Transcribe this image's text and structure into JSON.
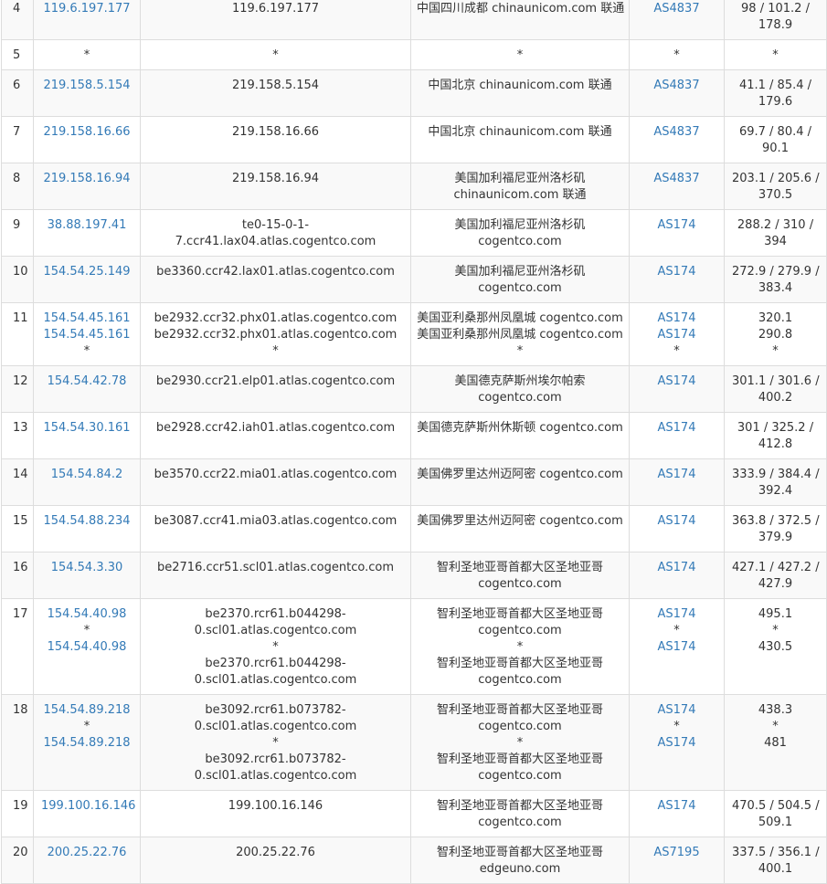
{
  "rows": [
    {
      "hop": "4",
      "ip": [
        "119.6.197.177"
      ],
      "host": [
        "119.6.197.177"
      ],
      "loc": [
        "中国四川成都 chinaunicom.com 联通"
      ],
      "as": [
        "AS4837"
      ],
      "rtt": "98 / 101.2 / 178.9"
    },
    {
      "hop": "5",
      "ip": [
        "*"
      ],
      "host": [
        "*"
      ],
      "loc": [
        "*"
      ],
      "as": [
        "*"
      ],
      "rtt": "*"
    },
    {
      "hop": "6",
      "ip": [
        "219.158.5.154"
      ],
      "host": [
        "219.158.5.154"
      ],
      "loc": [
        "中国北京 chinaunicom.com 联通"
      ],
      "as": [
        "AS4837"
      ],
      "rtt": "41.1 / 85.4 / 179.6"
    },
    {
      "hop": "7",
      "ip": [
        "219.158.16.66"
      ],
      "host": [
        "219.158.16.66"
      ],
      "loc": [
        "中国北京 chinaunicom.com 联通"
      ],
      "as": [
        "AS4837"
      ],
      "rtt": "69.7 / 80.4 / 90.1"
    },
    {
      "hop": "8",
      "ip": [
        "219.158.16.94"
      ],
      "host": [
        "219.158.16.94"
      ],
      "loc": [
        "美国加利福尼亚州洛杉矶 chinaunicom.com 联通"
      ],
      "as": [
        "AS4837"
      ],
      "rtt": "203.1 / 205.6 / 370.5"
    },
    {
      "hop": "9",
      "ip": [
        "38.88.197.41"
      ],
      "host": [
        "te0-15-0-1-7.ccr41.lax04.atlas.cogentco.com"
      ],
      "loc": [
        "美国加利福尼亚州洛杉矶 cogentco.com"
      ],
      "as": [
        "AS174"
      ],
      "rtt": "288.2 / 310 / 394"
    },
    {
      "hop": "10",
      "ip": [
        "154.54.25.149"
      ],
      "host": [
        "be3360.ccr42.lax01.atlas.cogentco.com"
      ],
      "loc": [
        "美国加利福尼亚州洛杉矶 cogentco.com"
      ],
      "as": [
        "AS174"
      ],
      "rtt": "272.9 / 279.9 / 383.4"
    },
    {
      "hop": "11",
      "ip": [
        "154.54.45.161",
        "154.54.45.161",
        "*"
      ],
      "host": [
        "be2932.ccr32.phx01.atlas.cogentco.com",
        "be2932.ccr32.phx01.atlas.cogentco.com",
        "*"
      ],
      "loc": [
        "美国亚利桑那州凤凰城 cogentco.com",
        "美国亚利桑那州凤凰城 cogentco.com",
        "*"
      ],
      "as": [
        "AS174",
        "AS174",
        "*"
      ],
      "rtt": "320.1\n290.8\n*"
    },
    {
      "hop": "12",
      "ip": [
        "154.54.42.78"
      ],
      "host": [
        "be2930.ccr21.elp01.atlas.cogentco.com"
      ],
      "loc": [
        "美国德克萨斯州埃尔帕索 cogentco.com"
      ],
      "as": [
        "AS174"
      ],
      "rtt": "301.1 / 301.6 / 400.2"
    },
    {
      "hop": "13",
      "ip": [
        "154.54.30.161"
      ],
      "host": [
        "be2928.ccr42.iah01.atlas.cogentco.com"
      ],
      "loc": [
        "美国德克萨斯州休斯顿 cogentco.com"
      ],
      "as": [
        "AS174"
      ],
      "rtt": "301 / 325.2 / 412.8"
    },
    {
      "hop": "14",
      "ip": [
        "154.54.84.2"
      ],
      "host": [
        "be3570.ccr22.mia01.atlas.cogentco.com"
      ],
      "loc": [
        "美国佛罗里达州迈阿密 cogentco.com"
      ],
      "as": [
        "AS174"
      ],
      "rtt": "333.9 / 384.4 / 392.4"
    },
    {
      "hop": "15",
      "ip": [
        "154.54.88.234"
      ],
      "host": [
        "be3087.ccr41.mia03.atlas.cogentco.com"
      ],
      "loc": [
        "美国佛罗里达州迈阿密 cogentco.com"
      ],
      "as": [
        "AS174"
      ],
      "rtt": "363.8 / 372.5 / 379.9"
    },
    {
      "hop": "16",
      "ip": [
        "154.54.3.30"
      ],
      "host": [
        "be2716.ccr51.scl01.atlas.cogentco.com"
      ],
      "loc": [
        "智利圣地亚哥首都大区圣地亚哥 cogentco.com"
      ],
      "as": [
        "AS174"
      ],
      "rtt": "427.1 / 427.2 / 427.9"
    },
    {
      "hop": "17",
      "ip": [
        "154.54.40.98",
        "*",
        "154.54.40.98"
      ],
      "host": [
        "be2370.rcr61.b044298-0.scl01.atlas.cogentco.com",
        "*",
        "be2370.rcr61.b044298-0.scl01.atlas.cogentco.com"
      ],
      "loc": [
        "智利圣地亚哥首都大区圣地亚哥 cogentco.com",
        "*",
        "智利圣地亚哥首都大区圣地亚哥 cogentco.com"
      ],
      "as": [
        "AS174",
        "*",
        "AS174"
      ],
      "rtt": "495.1\n*\n430.5"
    },
    {
      "hop": "18",
      "ip": [
        "154.54.89.218",
        "*",
        "154.54.89.218"
      ],
      "host": [
        "be3092.rcr61.b073782-0.scl01.atlas.cogentco.com",
        "*",
        "be3092.rcr61.b073782-0.scl01.atlas.cogentco.com"
      ],
      "loc": [
        "智利圣地亚哥首都大区圣地亚哥 cogentco.com",
        "*",
        "智利圣地亚哥首都大区圣地亚哥 cogentco.com"
      ],
      "as": [
        "AS174",
        "*",
        "AS174"
      ],
      "rtt": "438.3\n*\n481"
    },
    {
      "hop": "19",
      "ip": [
        "199.100.16.146"
      ],
      "host": [
        "199.100.16.146"
      ],
      "loc": [
        "智利圣地亚哥首都大区圣地亚哥 cogentco.com"
      ],
      "as": [
        "AS174"
      ],
      "rtt": "470.5 / 504.5 / 509.1"
    },
    {
      "hop": "20",
      "ip": [
        "200.25.22.76"
      ],
      "host": [
        "200.25.22.76"
      ],
      "loc": [
        "智利圣地亚哥首都大区圣地亚哥 edgeuno.com"
      ],
      "as": [
        "AS7195"
      ],
      "rtt": "337.5 / 356.1 / 400.1"
    }
  ]
}
